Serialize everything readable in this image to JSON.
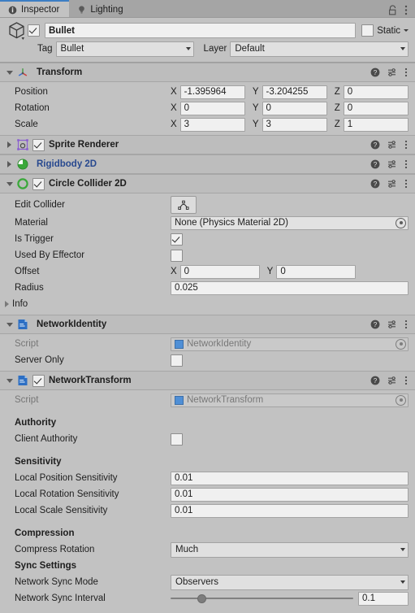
{
  "window": {
    "tabs": [
      {
        "label": "Inspector",
        "icon": "info-icon",
        "active": true
      },
      {
        "label": "Lighting",
        "icon": "lightbulb-icon",
        "active": false
      }
    ],
    "lock_icon": "lock-icon",
    "menu_icon": "kebab-menu-icon"
  },
  "game_object": {
    "icon": "cube-icon",
    "enabled": true,
    "name": "Bullet",
    "static_label": "Static",
    "static_checked": false,
    "tag_label": "Tag",
    "tag_value": "Bullet",
    "layer_label": "Layer",
    "layer_value": "Default"
  },
  "header_actions": {
    "help_icon": "help-icon",
    "preset_icon": "preset-settings-icon",
    "menu_icon": "kebab-menu-icon"
  },
  "transform": {
    "title": "Transform",
    "icon": "transform-axes-icon",
    "expanded": true,
    "rows": [
      {
        "label": "Position",
        "x": "-1.395964",
        "y": "-3.204255",
        "z": "0"
      },
      {
        "label": "Rotation",
        "x": "0",
        "y": "0",
        "z": "0"
      },
      {
        "label": "Scale",
        "x": "3",
        "y": "3",
        "z": "1"
      }
    ],
    "axis_labels": [
      "X",
      "Y",
      "Z"
    ]
  },
  "sprite_renderer": {
    "title": "Sprite Renderer",
    "icon": "sprite-renderer-icon",
    "expanded": false,
    "has_checkbox": true,
    "enabled": true
  },
  "rigidbody2d": {
    "title": "Rigidbody 2D",
    "icon": "rigidbody2d-icon",
    "expanded": false,
    "has_checkbox": false,
    "title_color": "#28498f"
  },
  "circle_collider2d": {
    "title": "Circle Collider 2D",
    "icon": "circle-collider-icon",
    "expanded": true,
    "has_checkbox": true,
    "enabled": true,
    "edit_collider_label": "Edit Collider",
    "edit_collider_icon": "edit-collider-icon",
    "material_label": "Material",
    "material_value": "None (Physics Material 2D)",
    "is_trigger_label": "Is Trigger",
    "is_trigger_checked": true,
    "used_by_effector_label": "Used By Effector",
    "used_by_effector_checked": false,
    "offset_label": "Offset",
    "offset_x": "0",
    "offset_y": "0",
    "radius_label": "Radius",
    "radius_value": "0.025",
    "info_label": "Info"
  },
  "network_identity": {
    "title": "NetworkIdentity",
    "icon": "cs-script-icon",
    "expanded": true,
    "has_checkbox": false,
    "script_label": "Script",
    "script_value": "NetworkIdentity",
    "server_only_label": "Server Only",
    "server_only_checked": false
  },
  "network_transform": {
    "title": "NetworkTransform",
    "icon": "cs-script-icon",
    "expanded": true,
    "has_checkbox": true,
    "enabled": true,
    "script_label": "Script",
    "script_value": "NetworkTransform",
    "authority_header": "Authority",
    "client_authority_label": "Client Authority",
    "client_authority_checked": false,
    "sensitivity_header": "Sensitivity",
    "local_position_sensitivity_label": "Local Position Sensitivity",
    "local_position_sensitivity_value": "0.01",
    "local_rotation_sensitivity_label": "Local Rotation Sensitivity",
    "local_rotation_sensitivity_value": "0.01",
    "local_scale_sensitivity_label": "Local Scale Sensitivity",
    "local_scale_sensitivity_value": "0.01",
    "compression_header": "Compression",
    "compress_rotation_label": "Compress Rotation",
    "compress_rotation_value": "Much",
    "sync_settings_header": "Sync Settings",
    "network_sync_mode_label": "Network Sync Mode",
    "network_sync_mode_value": "Observers",
    "network_sync_interval_label": "Network Sync Interval",
    "network_sync_interval_value": "0.1",
    "network_sync_interval_percent": 17
  },
  "colors": {
    "panel_bg": "#c2c2c2",
    "header_bg": "#bdbdbd",
    "tab_inactive": "#a5a5a5",
    "accent_blue": "#3d7ec4",
    "link_blue": "#28498f",
    "field_bg": "#f0f0f0",
    "disabled_text": "#767676"
  }
}
